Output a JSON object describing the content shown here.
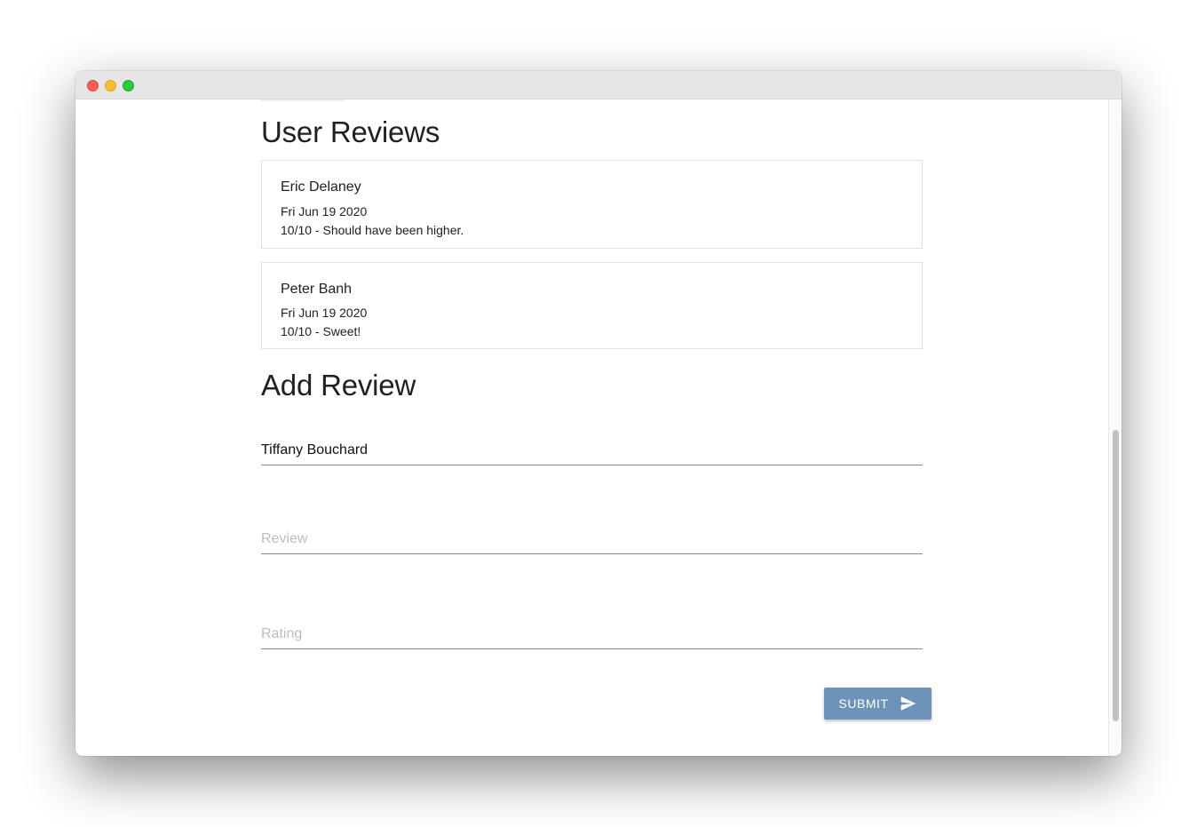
{
  "reviews_section": {
    "title": "User Reviews",
    "items": [
      {
        "name": "Eric Delaney",
        "date": "Fri Jun 19 2020",
        "comment": "10/10 - Should have been higher."
      },
      {
        "name": "Peter Banh",
        "date": "Fri Jun 19 2020",
        "comment": "10/10 - Sweet!"
      }
    ]
  },
  "add_review": {
    "title": "Add Review",
    "name_value": "Tiffany Bouchard",
    "review_placeholder": "Review",
    "review_value": "",
    "rating_placeholder": "Rating",
    "rating_value": "",
    "submit_label": "SUBMIT",
    "submit_icon": "send-icon"
  },
  "colors": {
    "submit_button": "#6d93b8",
    "traffic_red": "#fe5f57",
    "traffic_yellow": "#febc2e",
    "traffic_green": "#28c840"
  }
}
